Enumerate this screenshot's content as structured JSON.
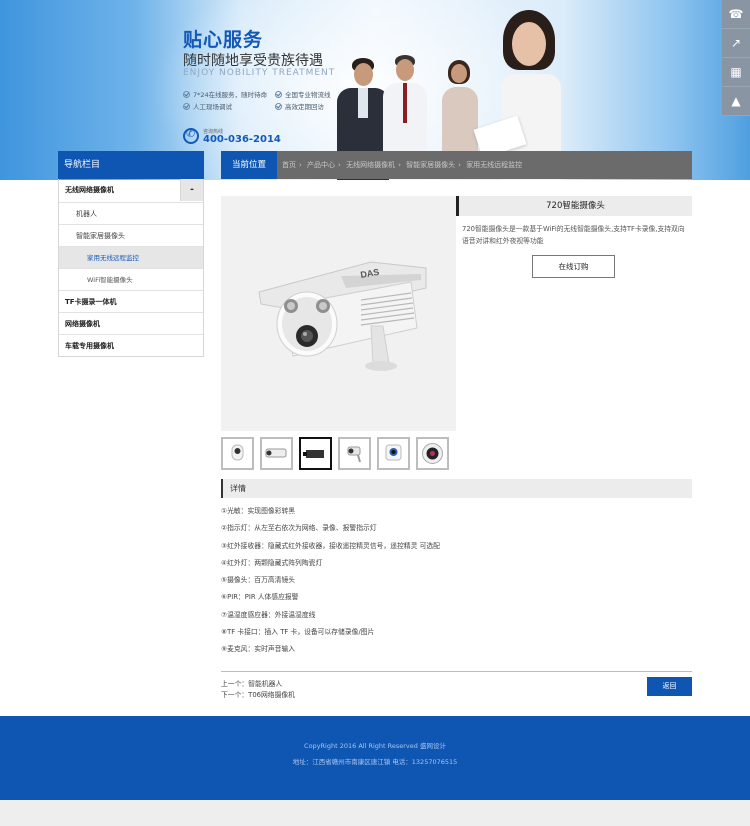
{
  "banner": {
    "title": "贴心服务",
    "subtitle": "随时随地享受贵族待遇",
    "english": "ENJOY NOBILITY TREATMENT",
    "features": [
      "7*24在线服务，随时待命",
      "全国专业物流线",
      "人工现场调试",
      "高效定期回访"
    ],
    "hotline_label": "咨询热线",
    "hotline": "400-036-2014"
  },
  "side_tools": {
    "icons": [
      "headset-icon",
      "share-icon",
      "qrcode-icon",
      "rocket-icon"
    ]
  },
  "nav": {
    "title": "导航栏目",
    "items": [
      {
        "label": "无线网络摄像机",
        "toggle": "-"
      },
      {
        "label": "机器人"
      },
      {
        "label": "智能家居摄像头"
      },
      {
        "label": "家用无线远程监控"
      },
      {
        "label": "WiFi智能摄像头"
      },
      {
        "label": "TF卡摄录一体机"
      },
      {
        "label": "网络摄像机"
      },
      {
        "label": "车载专用摄像机"
      }
    ]
  },
  "breadcrumb": {
    "current": "当前位置",
    "items": [
      "首页",
      "产品中心",
      "无线网络摄像机",
      "智能家居摄像头",
      "家用无线远程监控"
    ],
    "separator": "›"
  },
  "product": {
    "title": "720智能摄像头",
    "description": "720智能摄像头是一款基于WiFi的无线智能摄像头,支持TF卡录像,支持双向语音对讲和红外夜视等功能",
    "order_label": "在线订购",
    "camera_brand": "DAS"
  },
  "details": {
    "heading": "详情",
    "lines": [
      "①光敏：实现图像彩转黑",
      "②指示灯：从左至右依次为网络、录像、报警指示灯",
      "③红外接收器：隐藏式红外接收器，接收遥控精灵信号，遥控精灵 可选配",
      "④红外灯：两颗隐藏式阵列陶瓷灯",
      "⑤摄像头：百万高清镜头",
      "⑥PIR：PIR 人体感应报警",
      "⑦温湿度感应器：外接温湿度线",
      "⑧TF 卡接口：插入 TF 卡，设备可以存储录像/图片",
      "⑨麦克风：实时声音输入"
    ]
  },
  "prev_next": {
    "prev": "上一个：智能机器人",
    "next": "下一个：T06网络摄像机",
    "back_label": "返回"
  },
  "footer": {
    "copyright": "CopyRight 2016 All Right Reserved 盛网设计",
    "address": "地址：江西省赣州市南康区唐江镇  电话：13257076515"
  },
  "colors": {
    "brand_blue": "#0f56b3",
    "crumb_gray": "#6b6b6b"
  }
}
